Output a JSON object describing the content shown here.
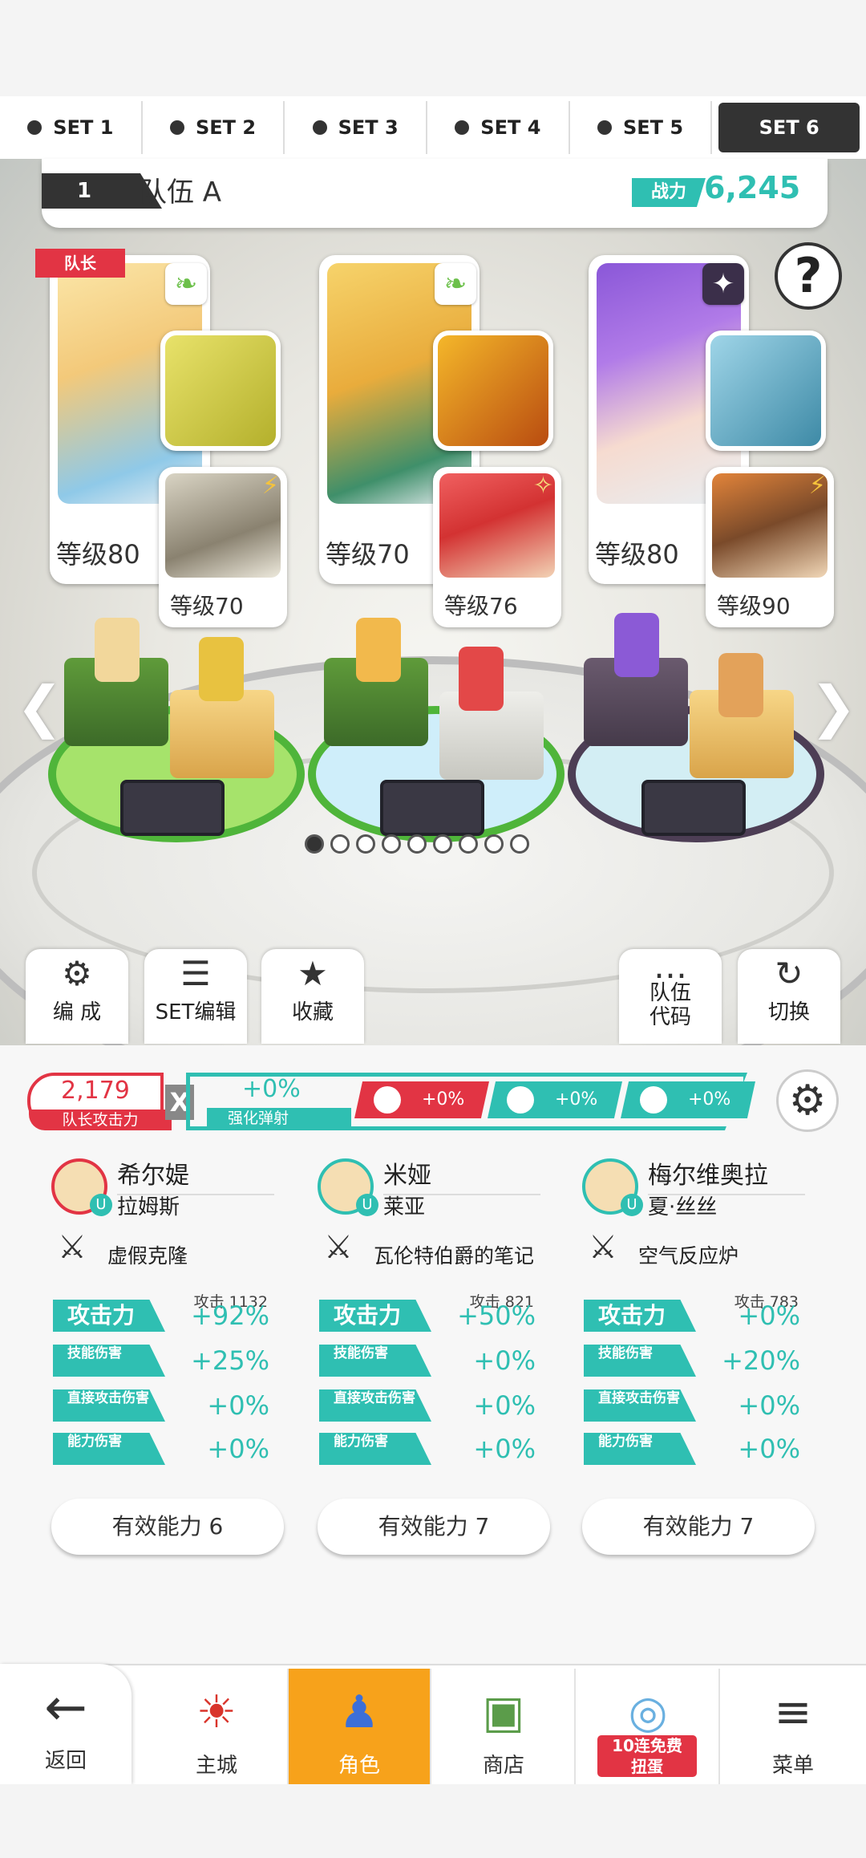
{
  "tabs": [
    "SET 1",
    "SET 2",
    "SET 3",
    "SET 4",
    "SET 5",
    "SET 6"
  ],
  "active_tab": "SET 6",
  "team": {
    "number": "1",
    "name": "队伍 A",
    "power_label": "战力",
    "power_value": "6,245"
  },
  "leader_tag": "队长",
  "help_icon": "?",
  "characters": [
    {
      "level": "等级80",
      "sub_level": "等级70",
      "element_icon": "leaf-icon"
    },
    {
      "level": "等级70",
      "sub_level": "等级76",
      "element_icon": "leaf-icon"
    },
    {
      "level": "等级80",
      "sub_level": "等级90",
      "element_icon": "dark-icon"
    }
  ],
  "actions": {
    "compose": "编 成",
    "set_edit": "SET编辑",
    "collect": "收藏",
    "team_code_1": "队伍",
    "team_code_2": "代码",
    "switch": "切换"
  },
  "leader_bonus": {
    "value": "2,179",
    "label": "队长攻击力"
  },
  "x_mark": "X",
  "boost": {
    "value": "+0%",
    "label": "强化弹射"
  },
  "chips": [
    "+0%",
    "+0%",
    "+0%"
  ],
  "columns": [
    {
      "name": "希尔媞",
      "model": "拉姆斯",
      "weapon": "虚假克隆",
      "atk_caption": "攻击 1132",
      "stats": [
        {
          "label": "攻击力",
          "value": "+92%"
        },
        {
          "label": "技能伤害",
          "value": "+25%"
        },
        {
          "label": "直接攻击伤害",
          "value": "+0%"
        },
        {
          "label": "能力伤害",
          "value": "+0%"
        }
      ],
      "effective": "有效能力 6"
    },
    {
      "name": "米娅",
      "model": "莱亚",
      "weapon": "瓦伦特伯爵的笔记",
      "atk_caption": "攻击   821",
      "stats": [
        {
          "label": "攻击力",
          "value": "+50%"
        },
        {
          "label": "技能伤害",
          "value": "+0%"
        },
        {
          "label": "直接攻击伤害",
          "value": "+0%"
        },
        {
          "label": "能力伤害",
          "value": "+0%"
        }
      ],
      "effective": "有效能力 7"
    },
    {
      "name": "梅尔维奥拉",
      "model": "夏·丝丝",
      "weapon": "空气反应炉",
      "atk_caption": "攻击   783",
      "stats": [
        {
          "label": "攻击力",
          "value": "+0%"
        },
        {
          "label": "技能伤害",
          "value": "+20%"
        },
        {
          "label": "直接攻击伤害",
          "value": "+0%"
        },
        {
          "label": "能力伤害",
          "value": "+0%"
        }
      ],
      "effective": "有效能力 7"
    }
  ],
  "nav": {
    "back": "返回",
    "town": "主城",
    "character": "角色",
    "shop": "商店",
    "gacha_badge_1": "10连免费",
    "gacha_badge_2": "扭蛋",
    "menu": "菜单"
  },
  "pager": {
    "total": 10,
    "current": 1
  },
  "colors": {
    "accent": "#2fbfb2",
    "red": "#e23444",
    "nav_selected": "#f7a21b"
  }
}
